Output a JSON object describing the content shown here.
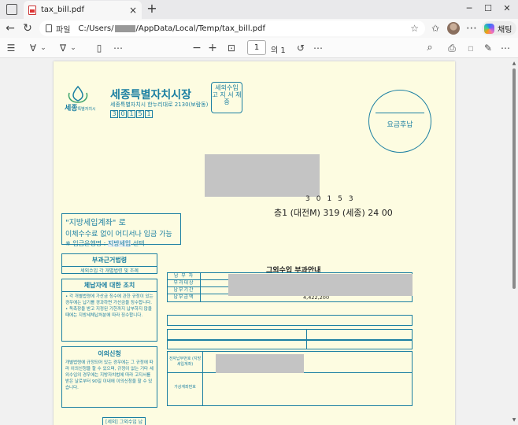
{
  "browser": {
    "tab_title": "tax_bill.pdf",
    "tab_close": "×",
    "new_tab": "+",
    "win_min": "─",
    "win_max": "☐",
    "win_close": "✕",
    "url_scheme": "파일",
    "url_prefix": "C:/Users/",
    "url_suffix": "/AppData/Local/Temp/tax_bill.pdf",
    "copilot_label": "채팅",
    "nav_back": "←",
    "nav_refresh": "↻",
    "star": "☆",
    "favorites_icon": "✩",
    "collections_icon": "⧉",
    "more": "⋯"
  },
  "pdf_toolbar": {
    "contents": "☰",
    "draw": "∀",
    "highlight": "∇",
    "chevron": "⌄",
    "page_view": "▯",
    "more": "⋯",
    "zoom_out": "−",
    "zoom_in": "+",
    "fit": "⊡",
    "page_current": "1",
    "page_total": "의 1",
    "rotate": "↺",
    "search": "⌕",
    "print": "⎙",
    "save": "▫",
    "save_as": "✎"
  },
  "bill": {
    "logo_name": "세종",
    "logo_sub": "특별자치시",
    "issuer": "세종특별자치시장",
    "issuer_address": "세종특별자치시 한누리대로 2130(보람동)",
    "postcode_digits": [
      "3",
      "0",
      "1",
      "5",
      "1"
    ],
    "stamp_box": "세외수입 고 지 서 재 중",
    "payment_stamp": "요금후납",
    "recipient_postcode": "30153",
    "recipient_address": "층1 (대전M) 319 (세종) 24 00",
    "bank_line1": "\"지방세입계좌\" 로",
    "bank_line2": "이체수수료 없이 어디서나 입금 가능",
    "bank_line3_prefix": "※ 입금은행명 : ",
    "bank_line3_bank": "지방세입",
    "bank_line3_suffix": " 선택",
    "panel_basis_title": "부과근거법령",
    "panel_basis_text": "세외수입 각 개별법령 및 조례",
    "panel_delinquent_title": "체납자에 대한 조치",
    "panel_delinquent_text": "• 각 개별법령에 가산금 징수에 관한 규정이 있는 경우에는 납기를 경과하면 가산금을 징수합니다. • 독촉장을 받고 지정된 기한까지 납부하지 않을 때에는 지방세체납처분에 따라 징수합니다.",
    "panel_objection_title": "이의신청",
    "panel_objection_text": "개별법령에 규정되어 있는 경우에는 그 규정에 따라 이의신청을 할 수 있으며, 규정이 없는 기타 세외수입의 경우에는 지방자치법에 따라 고지서를 받은 날로부터 90일 이내에 이의신청을 할 수 있습니다.",
    "notice_title": "그외수입 부과안내",
    "info_rows": [
      {
        "label": "납 부 자",
        "value": ""
      },
      {
        "label": "부과대상",
        "value": ""
      },
      {
        "label": "납부기간",
        "value": ""
      },
      {
        "label": "납부금액",
        "value": "4,422,200"
      }
    ],
    "acct_label_1": "전자납부번호 (지방세입계좌)",
    "acct_label_2": "가상계좌번호",
    "footer_tag": "[세외] 그외수입 납"
  }
}
